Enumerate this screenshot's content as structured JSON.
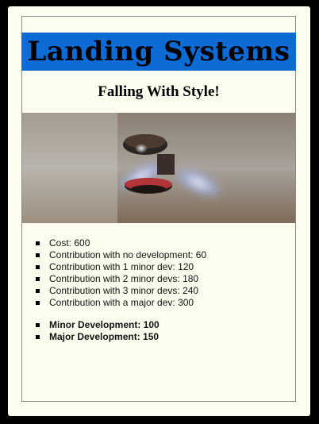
{
  "card": {
    "title": "Landing Systems",
    "subtitle": "Falling With Style!",
    "accent_color": "#0d6bd6",
    "background_color": "#fefef0",
    "image": {
      "icon": "ceiling-fan-photo"
    },
    "stats": [
      "Cost: 600",
      "Contribution with no development: 60",
      "Contribution with 1 minor dev: 120",
      "Contribution with 2 minor devs: 180",
      "Contribution with 3 minor devs: 240",
      "Contribution with a major dev: 300"
    ],
    "developments": [
      "Minor Development: 100",
      "Major Development: 150"
    ]
  }
}
